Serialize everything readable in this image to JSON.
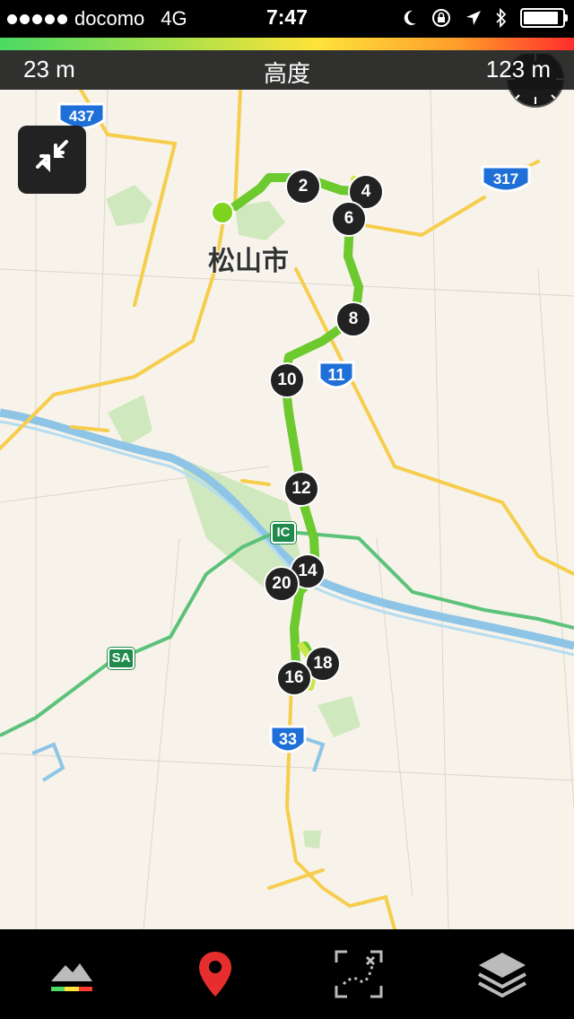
{
  "status_bar": {
    "carrier": "docomo",
    "network": "4G",
    "time": "7:47"
  },
  "elevation_bar": {
    "min_label": "23 m",
    "title": "高度",
    "max_label": "123 m"
  },
  "map": {
    "city_label": "松山市",
    "route_badges": [
      "437",
      "317",
      "11",
      "33"
    ],
    "ic_label": "IC",
    "sa_label": "SA",
    "markers": [
      "2",
      "4",
      "6",
      "8",
      "10",
      "12",
      "14",
      "20",
      "18",
      "16"
    ]
  },
  "colors": {
    "route_line": "#6cc92e",
    "road": "#f6cd4c",
    "expressway": "#5cc27a",
    "river": "#8ec5e6",
    "park": "#c8e6b4",
    "marker": "#222222"
  },
  "tab_bar": {
    "items": [
      "elevation-profile-icon",
      "location-pin-icon",
      "track-route-icon",
      "layers-icon"
    ]
  }
}
